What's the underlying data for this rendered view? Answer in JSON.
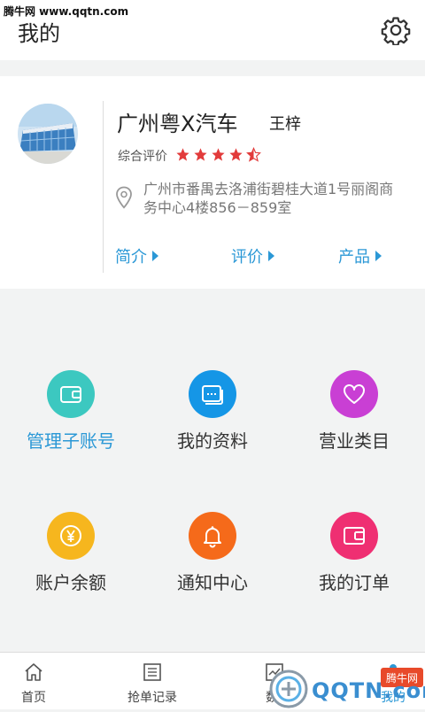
{
  "watermark": "腾牛网 www.qqtn.com",
  "header": {
    "title": "我的",
    "settings_icon": "gear-icon"
  },
  "profile": {
    "shop_name": "广州粤X汽车",
    "owner": "王梓",
    "rating_label": "综合评价",
    "rating": 4.5,
    "rating_max": 5,
    "address": "广州市番禺去洛浦街碧桂大道1号丽阁商务中心4楼856－859室",
    "links": [
      {
        "label": "简介"
      },
      {
        "label": "评价"
      },
      {
        "label": "产品"
      }
    ]
  },
  "grid": [
    {
      "label": "管理子账号",
      "color": "#3cc8c0",
      "icon": "wallet-icon",
      "label_color": "#2b98d6"
    },
    {
      "label": "我的资料",
      "color": "#1596e6",
      "icon": "card-icon",
      "label_color": "#333333"
    },
    {
      "label": "营业类目",
      "color": "#c93fd4",
      "icon": "heart-icon",
      "label_color": "#333333"
    },
    {
      "label": "账户余额",
      "color": "#f6b61e",
      "icon": "yuan-coin-icon",
      "label_color": "#333333"
    },
    {
      "label": "通知中心",
      "color": "#f56a1a",
      "icon": "bell-icon",
      "label_color": "#333333"
    },
    {
      "label": "我的订单",
      "color": "#ef2f72",
      "icon": "order-icon",
      "label_color": "#333333"
    }
  ],
  "tabbar": {
    "tabs": [
      {
        "label": "首页",
        "icon": "home-icon"
      },
      {
        "label": "抢单记录",
        "icon": "list-icon"
      },
      {
        "label": "数",
        "icon": "chart-icon"
      },
      {
        "label": "我的",
        "icon": "person-icon"
      }
    ]
  },
  "brand_watermark": {
    "text": "QQTN.com",
    "badge": "腾牛网"
  },
  "colors": {
    "accent": "#2b98d6",
    "star": "#e23b3b"
  }
}
